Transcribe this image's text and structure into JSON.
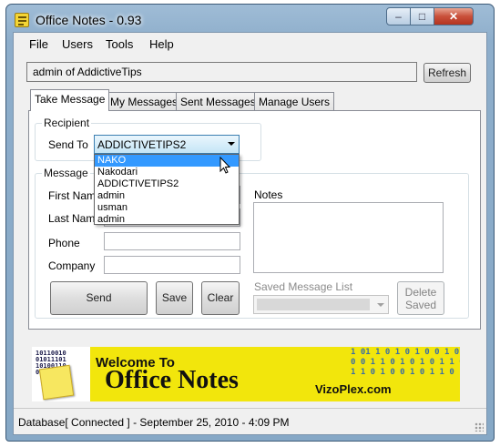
{
  "window": {
    "title": "Office Notes - 0.93",
    "min": "–",
    "max": "□",
    "close": "✕"
  },
  "menu": [
    "File",
    "Users",
    "Tools",
    "Help"
  ],
  "user_field": {
    "value": "admin of AddictiveTips"
  },
  "refresh_label": "Refresh",
  "tabs": [
    "Take Message",
    "My Messages",
    "Sent Messages",
    "Manage Users"
  ],
  "recipient": {
    "group_label": "Recipient",
    "send_to_label": "Send To",
    "selected": "ADDICTIVETIPS2",
    "options": [
      "NAKO",
      "Nakodari",
      "ADDICTIVETIPS2",
      "admin",
      "usman",
      "admin"
    ]
  },
  "message": {
    "group_label": "Message",
    "first_name_label": "First Name",
    "last_name_label": "Last Name",
    "phone_label": "Phone",
    "company_label": "Company",
    "notes_label": "Notes",
    "saved_list_label": "Saved Message List",
    "send_label": "Send",
    "save_label": "Save",
    "clear_label": "Clear",
    "delete_saved_line1": "Delete",
    "delete_saved_line2": "Saved"
  },
  "banner": {
    "welcome": "Welcome To",
    "title": "Office Notes",
    "site": "VizoPlex.com"
  },
  "status": "Database[ Connected ] - September 25, 2010 - 4:09 PM"
}
